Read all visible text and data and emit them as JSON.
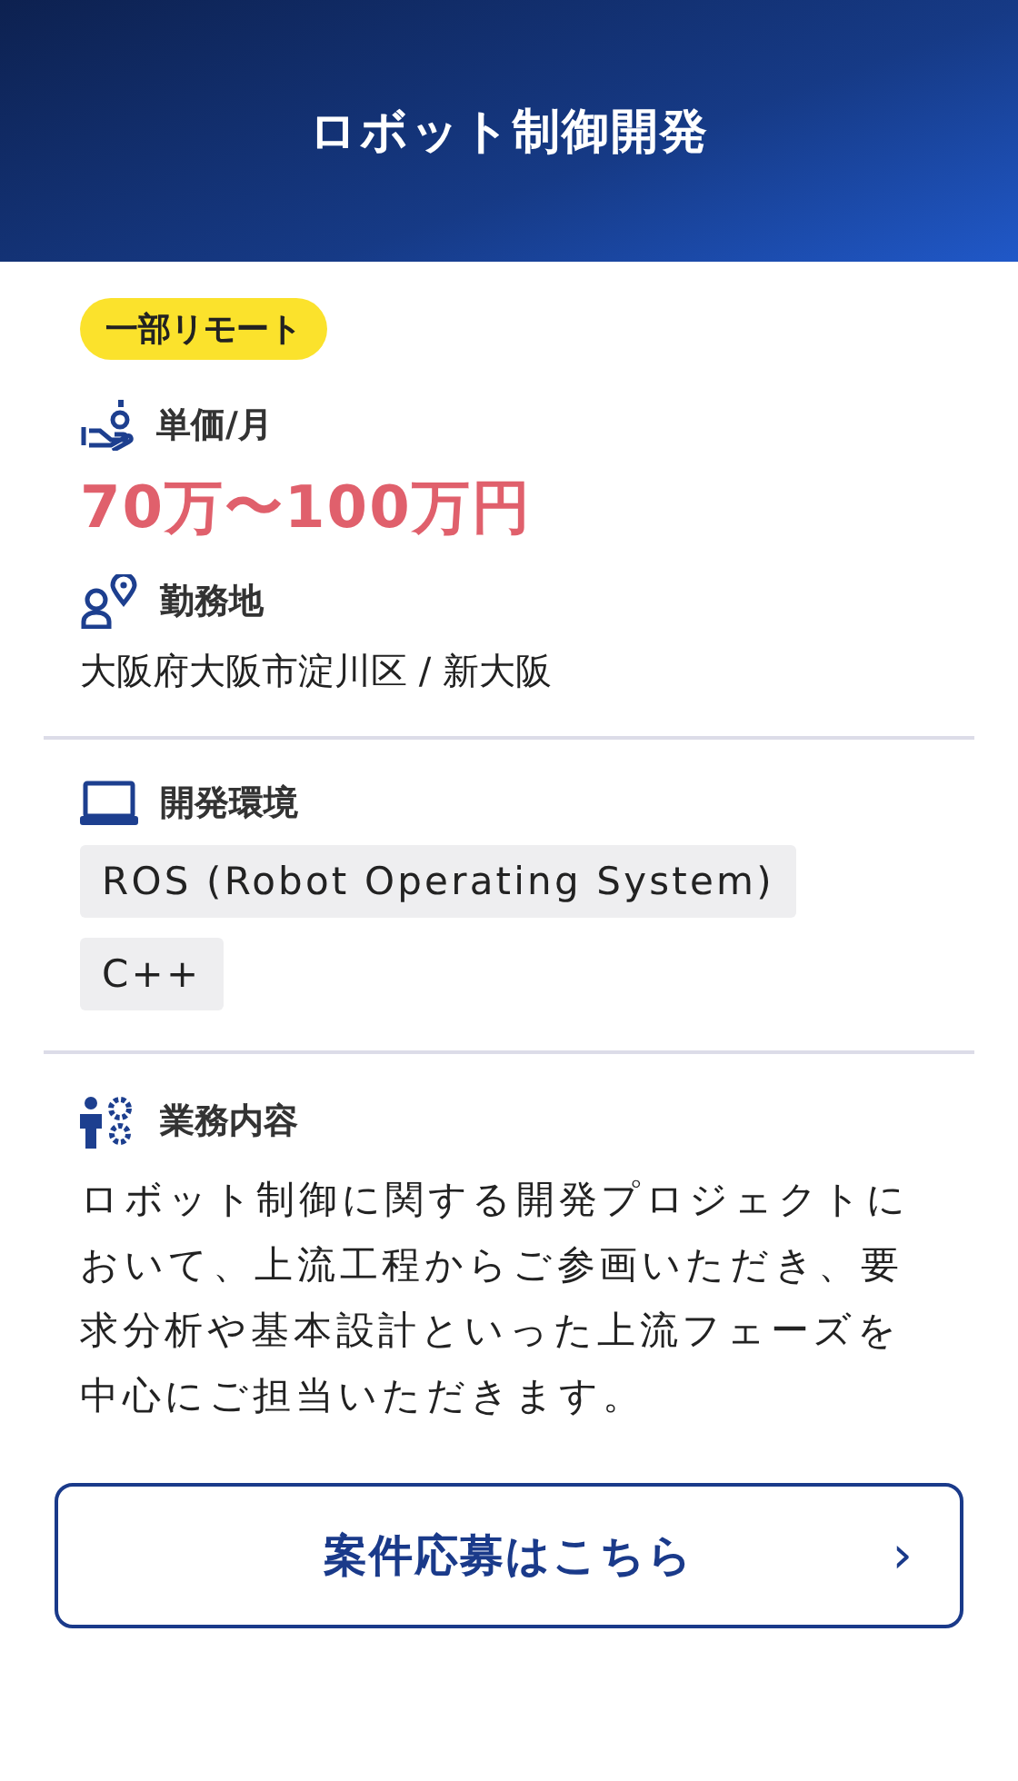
{
  "header": {
    "title": "ロボット制御開発"
  },
  "badge": "一部リモート",
  "groups": [
    {
      "items": [
        {
          "kind": "price",
          "label": "単価/月",
          "value": "70万〜100万円"
        },
        {
          "kind": "location",
          "label": "勤務地",
          "value": "大阪府大阪市淀川区 / 新大阪"
        }
      ]
    },
    {
      "items": [
        {
          "kind": "tags",
          "label": "開発環境",
          "tags": [
            "ROS (Robot Operating System)",
            "C++"
          ]
        }
      ]
    },
    {
      "items": [
        {
          "kind": "work",
          "label": "業務内容",
          "value": "ロボット制御に関する開発プロジェクトにおいて、上流工程からご参画いただき、要求分析や基本設計といった上流フェーズを中心にご担当いただきます。"
        }
      ]
    }
  ],
  "apply_button": {
    "label": "案件応募はこちら",
    "arrow": "›"
  }
}
